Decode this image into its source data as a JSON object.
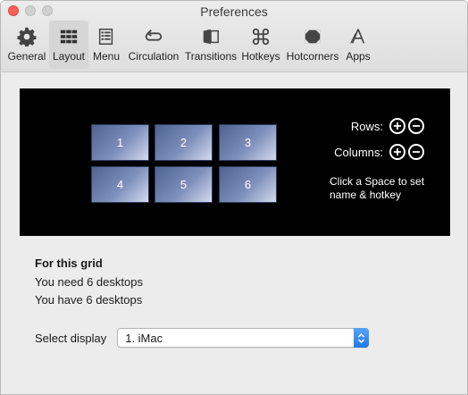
{
  "window": {
    "title": "Preferences"
  },
  "toolbar": {
    "items": [
      {
        "label": "General",
        "icon": "gear-icon"
      },
      {
        "label": "Layout",
        "icon": "grid-icon",
        "active": true
      },
      {
        "label": "Menu",
        "icon": "menu-icon"
      },
      {
        "label": "Circulation",
        "icon": "circulation-icon"
      },
      {
        "label": "Transitions",
        "icon": "transitions-icon"
      },
      {
        "label": "Hotkeys",
        "icon": "command-icon"
      },
      {
        "label": "Hotcorners",
        "icon": "hotcorners-icon"
      },
      {
        "label": "Apps",
        "icon": "apps-icon"
      }
    ]
  },
  "grid": {
    "spaces": [
      "1",
      "2",
      "3",
      "4",
      "5",
      "6"
    ],
    "rows_label": "Rows:",
    "columns_label": "Columns:",
    "hint": "Click a Space to set name & hotkey"
  },
  "info": {
    "heading": "For this grid",
    "need": "You need 6 desktops",
    "have": "You have 6 desktops"
  },
  "display": {
    "label": "Select display",
    "selected": "1. iMac"
  },
  "colors": {
    "close_button": "#fc605c",
    "grid_background": "#000000",
    "space_tile": "#6f82ad",
    "select_stepper": "#1f7ae8"
  }
}
